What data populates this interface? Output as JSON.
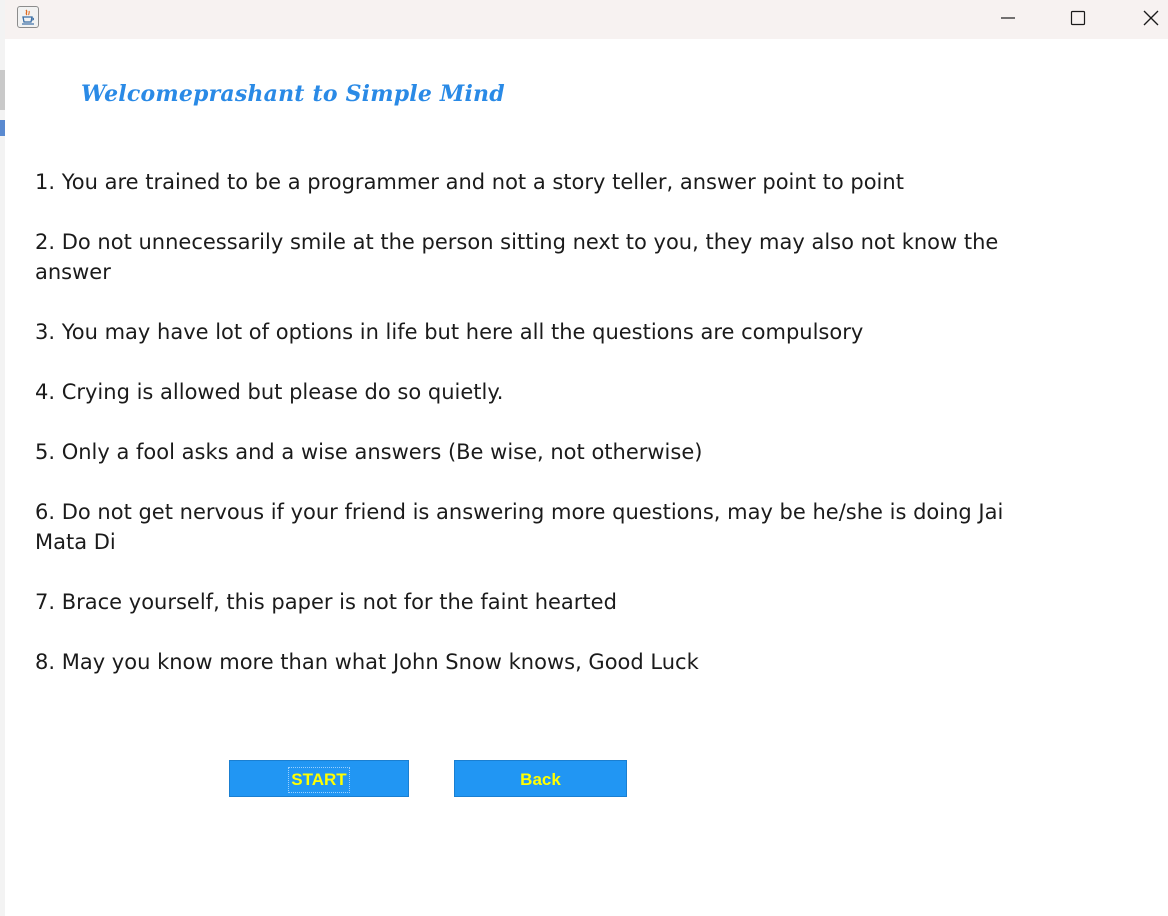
{
  "window": {
    "title": "",
    "controls": {
      "minimize": "minimize-icon",
      "maximize": "maximize-icon",
      "close": "close-icon"
    }
  },
  "app_icon": "java-icon",
  "welcome": "Welcomeprashant to Simple Mind",
  "rules": [
    "1. You are trained to be a programmer and not a story teller, answer point to point",
    "2. Do not unnecessarily smile at the person sitting next to you, they may also not know the\nanswer",
    "3. You may have lot of options in life but here all the questions are compulsory",
    "4. Crying is allowed but please do so quietly.",
    "5. Only a fool asks and a wise answers (Be wise, not otherwise)",
    "6. Do not get nervous if your friend is answering more questions, may be he/she is doing Jai\nMata Di",
    "7. Brace yourself, this paper is not for the faint hearted",
    "8. May you know more than what John Snow knows, Good Luck"
  ],
  "buttons": {
    "start": "START",
    "back": "Back"
  },
  "colors": {
    "welcome_text": "#2a8ae6",
    "button_bg": "#2196f3",
    "button_text": "#ffff00",
    "titlebar_bg": "#f7f2f1"
  }
}
